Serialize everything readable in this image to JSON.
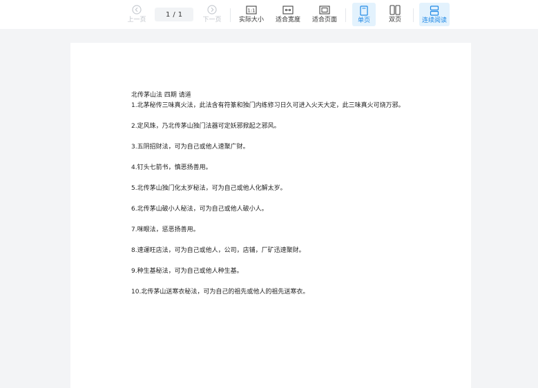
{
  "toolbar": {
    "prev_label": "上一页",
    "next_label": "下一页",
    "page_current": "1",
    "page_separator": "/",
    "page_total": "1",
    "actual_size_label": "实际大小",
    "fit_width_label": "适合宽度",
    "fit_page_label": "适合页面",
    "single_page_label": "单页",
    "double_page_label": "双页",
    "continuous_label": "连续阅读",
    "accent_color": "#1e88e5",
    "active_bg": "#e3f2fd",
    "active_item": "continuous_label"
  },
  "document": {
    "title": "北传茅山法 四期 请道",
    "items": [
      "1.北茅秘传三味真火法，此法含有符篆和独门内练修习日久可进入火天大定，此三味真火可烧万邪。",
      "2.定风珠，乃北传茅山独门法器可定妖邪掀起之邪风。",
      "3.五阴招财法，可为自己或他人速聚广财。",
      "4.钉头七箭书，慎⁠恶扬善用。",
      "5.北传茅山独门化太岁秘法，可为自己或他人化解太岁。",
      "6.北传茅山破小人秘法，可为自己或他人破小人。",
      "7.咪眼法，惩恶扬善用。",
      "8.速運旺店法，可为自己或他人，公司，店铺，厂矿迅速聚财。",
      "9.种生基秘法，可为自己或他人种生基。",
      "10.北传茅山送寒衣秘法，可为自己的祖先或他人的祖先送寒衣。"
    ]
  }
}
